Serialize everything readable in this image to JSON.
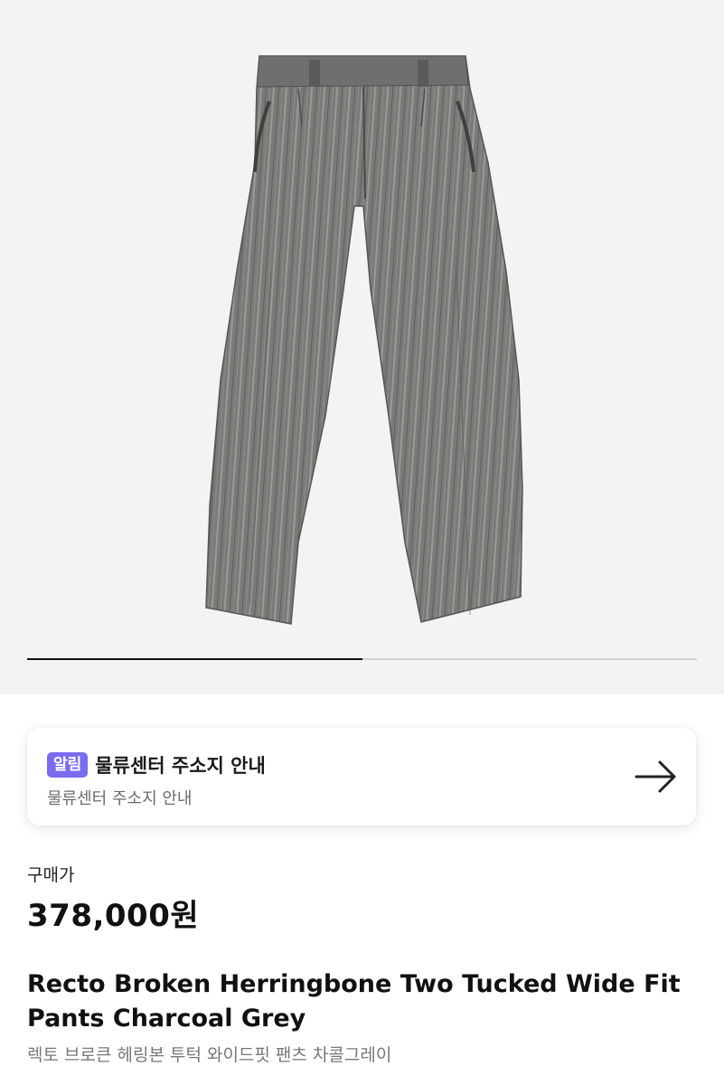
{
  "gallery": {
    "image_alt": "pants",
    "progress": 0.5
  },
  "notice": {
    "badge": "알림",
    "title": "물류센터 주소지 안내",
    "subtitle": "물류센터 주소지 안내",
    "icon": "arrow-right-icon",
    "badge_color": "#7a6cf0"
  },
  "pricing": {
    "label": "구매가",
    "price": "378,000원"
  },
  "product": {
    "name_en": "Recto Broken Herringbone Two Tucked Wide Fit Pants Charcoal Grey",
    "name_ko": "렉토 브로큰 헤링본 투턱 와이드핏 팬츠 차콜그레이"
  }
}
